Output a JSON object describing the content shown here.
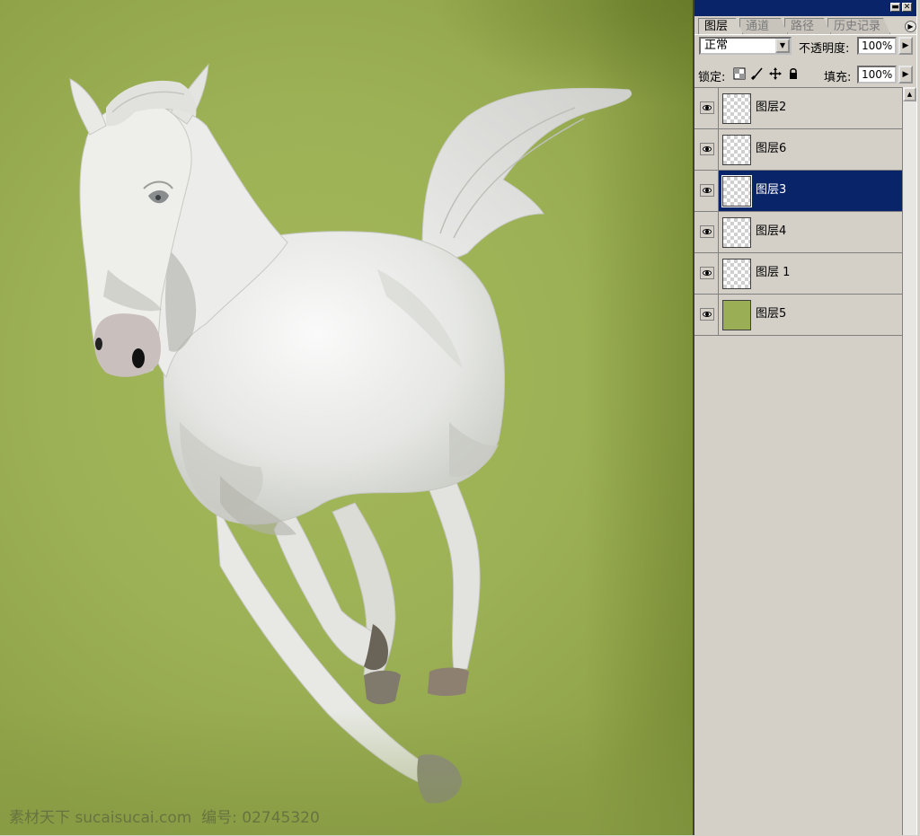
{
  "palette": {
    "tabs": [
      {
        "label": "图层",
        "active": true
      },
      {
        "label": "通道",
        "active": false
      },
      {
        "label": "路径",
        "active": false
      },
      {
        "label": "历史记录",
        "active": false
      }
    ],
    "blend_mode": "正常",
    "opacity_label": "不透明度:",
    "opacity_value": "100%",
    "lock_label": "锁定:",
    "fill_label": "填充:",
    "fill_value": "100%",
    "lock_icons": [
      "lock-transparent-icon",
      "lock-paint-icon",
      "lock-move-icon",
      "lock-all-icon"
    ],
    "layers": [
      {
        "name": "图层2",
        "visible": true,
        "selected": false,
        "thumb": "transparent"
      },
      {
        "name": "图层6",
        "visible": true,
        "selected": false,
        "thumb": "transparent"
      },
      {
        "name": "图层3",
        "visible": true,
        "selected": true,
        "thumb": "transparent"
      },
      {
        "name": "图层4",
        "visible": true,
        "selected": false,
        "thumb": "transparent"
      },
      {
        "name": "图层 1",
        "visible": true,
        "selected": false,
        "thumb": "transparent"
      },
      {
        "name": "图层5",
        "visible": true,
        "selected": false,
        "thumb": "fill"
      }
    ]
  },
  "canvas": {
    "background_color": "#9cb055",
    "watermark": "素材天下 sucaisucai.com  编号: 02745320"
  },
  "colors": {
    "titlebar": "#0a246a",
    "selected_row": "#0a246a",
    "panel": "#d4d0c8"
  }
}
